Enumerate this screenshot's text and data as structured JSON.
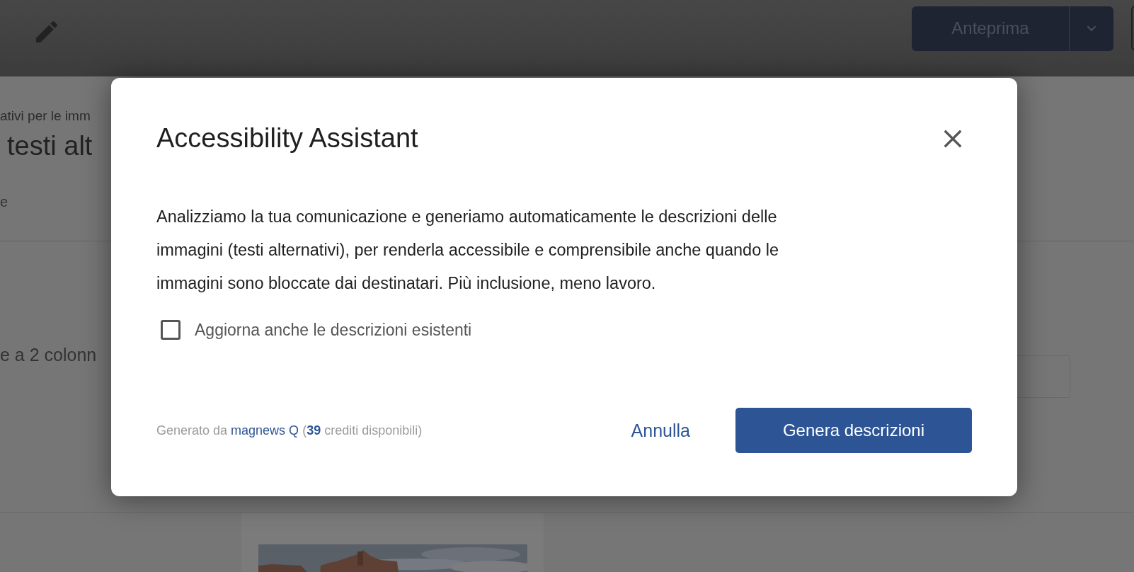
{
  "background_page": {
    "preview_button": {
      "label": "Anteprima"
    },
    "subtitle": "ativi per le imm",
    "heading": "testi alt",
    "tab": "e",
    "layout_label": "e a 2 colonn"
  },
  "dialog": {
    "title": "Accessibility Assistant",
    "body": "Analizziamo la tua comunicazione e generiamo automaticamente le descrizioni delle immagini (testi alternativi), per renderla accessibile e comprensibile anche quando le immagini sono bloccate dai destinatari. Più inclusione, meno lavoro.",
    "checkbox": {
      "label": "Aggiorna anche le descrizioni esistenti",
      "checked": false
    },
    "footer": {
      "prefix": "Generato da",
      "link": "magnews Q",
      "suffix": "(**39** crediti disponibili)"
    },
    "buttons": [
      {
        "label": "Annulla",
        "kind": "text"
      },
      {
        "label": "Genera descrizioni",
        "kind": "primary"
      }
    ]
  }
}
